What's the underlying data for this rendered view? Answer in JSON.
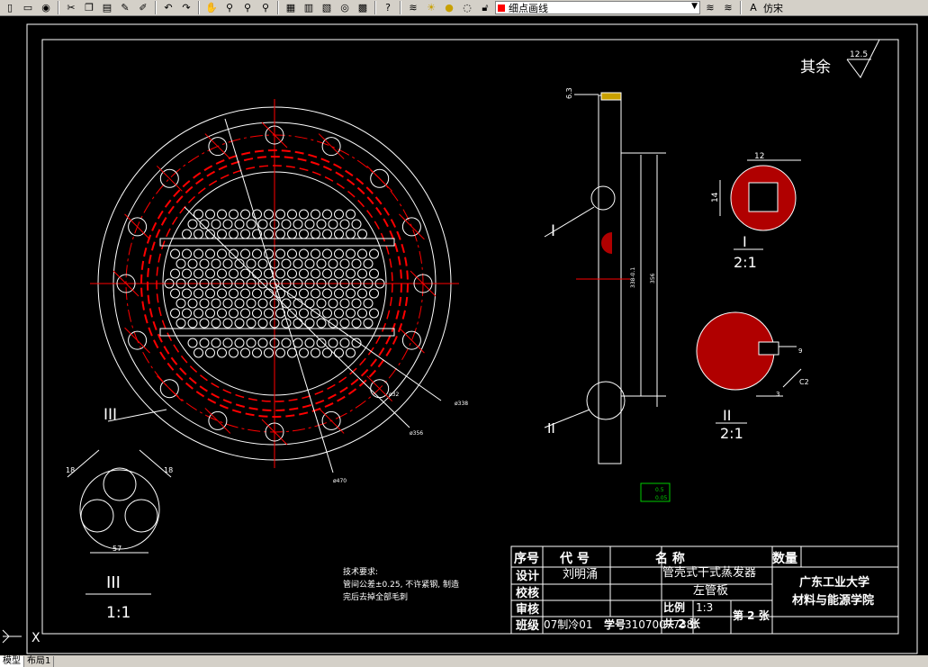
{
  "toolbar": {
    "icons": [
      "new-icon",
      "open-icon",
      "save-icon",
      "cut-icon",
      "copy-icon",
      "paste-icon",
      "brush-icon",
      "match-icon",
      "undo-icon",
      "redo-icon",
      "pan-icon",
      "zoom-realtime-icon",
      "zoom-window-icon",
      "zoom-previous-icon",
      "properties-icon",
      "design-center-icon",
      "tool-palette-icon",
      "calculator-icon",
      "help-icon"
    ],
    "layer_name": "细点画线",
    "font_label": "仿宋"
  },
  "drawing": {
    "surface_mark": "其余",
    "surface_value": "12.5",
    "dim_338": "ø338",
    "dim_356": "ø356",
    "dim_470": "ø470",
    "dim_32": "ø32",
    "label_I": "I",
    "label_II": "II",
    "label_III": "III",
    "scale_21": "2:1",
    "scale_11": "1:1",
    "dim_12": "12",
    "dim_14": "14",
    "dim_9": "9",
    "dim_3": "3",
    "dim_c2": "C2",
    "dim_57": "57",
    "dim_18a": "18",
    "dim_18b": "18",
    "dim_63": "6.3",
    "dim_356v": "356",
    "dim_3380": "338-0.1",
    "tol_1": "0.5",
    "tol_2": "0.05",
    "tech_title": "技术要求:",
    "tech_line1": "管间公差±0.25, 不许紧钢, 制造",
    "tech_line2": "完后去掉全部毛刺"
  },
  "titleblock": {
    "h_seq": "序号",
    "h_code": "代  号",
    "h_name": "名      称",
    "h_qty": "数量",
    "design_label": "设计",
    "designer": "刘明涌",
    "check_label": "校核",
    "review_label": "审核",
    "part_name_1": "管壳式干式蒸发器",
    "part_name_2": "左管板",
    "scale_label": "比例",
    "scale_value": "1:3",
    "sheets_total": "共 2  张",
    "sheet_no": "第 2  张",
    "class_label": "班级",
    "class_value": "07制冷01",
    "student_no_label": "学号",
    "student_no": "3107007738",
    "school_1": "广东工业大学",
    "school_2": "材料与能源学院"
  },
  "tabs": {
    "model": "模型",
    "layout1": "布局1"
  }
}
